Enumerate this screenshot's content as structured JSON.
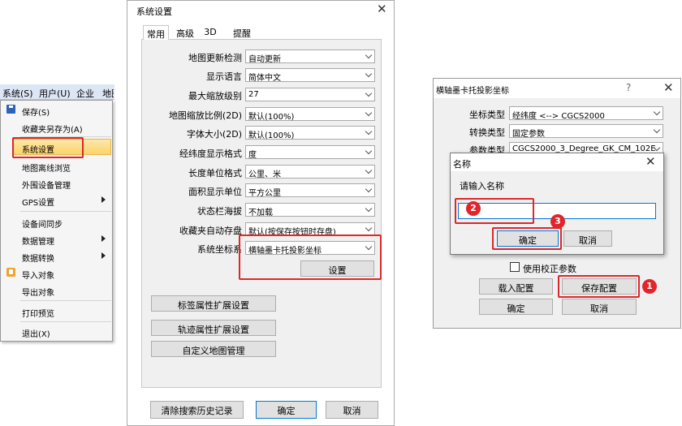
{
  "menu": {
    "bar": [
      "系统(S)",
      "用户(U)",
      "企业",
      "地图"
    ],
    "items": [
      "保存(S)",
      "收藏夹另存为(A)",
      "系统设置",
      "地图离线浏览",
      "外围设备管理",
      "GPS设置",
      "设备间同步",
      "数据管理",
      "数据转换",
      "导入对象",
      "导出对象",
      "打印预览",
      "退出(X)"
    ]
  },
  "sys": {
    "title": "系统设置",
    "tabs": [
      "常用",
      "高级",
      "3D",
      "提醒"
    ],
    "labels": [
      "地图更新检测",
      "显示语言",
      "最大缩放级别",
      "地图缩放比例(2D)",
      "字体大小(2D)",
      "经纬度显示格式",
      "长度单位格式",
      "面积显示单位",
      "状态栏海拔",
      "收藏夹自动存盘",
      "系统坐标系"
    ],
    "values": [
      "自动更新",
      "简体中文",
      "27",
      "默认(100%)",
      "默认(100%)",
      "度",
      "公里、米",
      "平方公里",
      "不加载",
      "默认(按保存按钮时存盘)",
      "横轴墨卡托投影坐标"
    ],
    "setting_btn": "设置",
    "ext_btns": [
      "标签属性扩展设置",
      "轨迹属性扩展设置",
      "自定义地图管理"
    ],
    "clear_btn": "清除搜索历史记录",
    "ok": "确定",
    "cancel": "取消"
  },
  "tm": {
    "title": "横轴墨卡托投影坐标",
    "help": "?",
    "labels": [
      "坐标类型",
      "转换类型",
      "参数类型"
    ],
    "values": [
      "经纬度 <--> CGCS2000",
      "固定参数",
      "CGCS2000_3_Degree_GK_CM_102E"
    ],
    "checkbox": "使用校正参数",
    "load_btn": "载入配置",
    "save_btn": "保存配置",
    "ok": "确定",
    "cancel": "取消"
  },
  "name": {
    "title": "名称",
    "prompt": "请输入名称",
    "input_value": "",
    "ok": "确定",
    "cancel": "取消"
  },
  "badges": [
    "1",
    "2",
    "3"
  ],
  "colors": {
    "highlight": "#e0262a",
    "menu_selected": "#fbd36b"
  }
}
